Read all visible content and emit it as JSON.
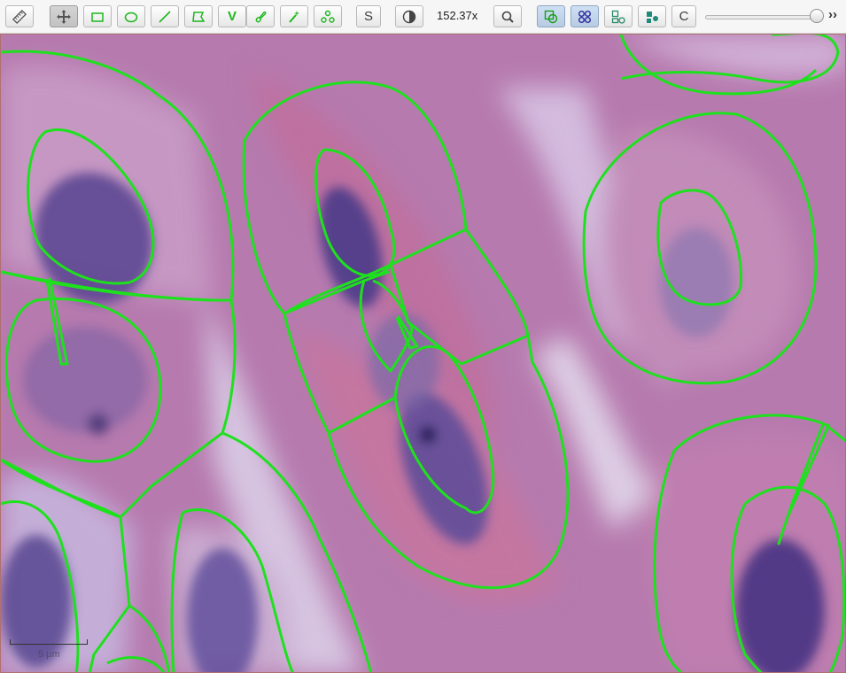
{
  "toolbar": {
    "tools": [
      {
        "name": "ruler-tool",
        "icon": "ruler-icon"
      },
      {
        "name": "pan-tool",
        "icon": "move-arrows-icon",
        "active": true
      },
      {
        "name": "rectangle-tool",
        "icon": "rectangle-icon"
      },
      {
        "name": "ellipse-tool",
        "icon": "ellipse-icon"
      },
      {
        "name": "line-tool",
        "icon": "line-icon"
      },
      {
        "name": "polygon-tool",
        "icon": "polygon-icon"
      },
      {
        "name": "polyline-tool",
        "icon": "v-letter-icon",
        "label": "V"
      },
      {
        "name": "brush-tool",
        "icon": "brush-icon"
      },
      {
        "name": "wand-tool",
        "icon": "magic-wand-icon"
      },
      {
        "name": "points-tool",
        "icon": "points-icon"
      },
      {
        "name": "selection-mode",
        "icon": "s-letter-icon",
        "label": "S"
      },
      {
        "name": "contrast-toggle",
        "icon": "contrast-icon"
      }
    ],
    "zoom_label": "152.37x",
    "right_tools": [
      {
        "name": "zoom-button",
        "icon": "magnifier-icon"
      },
      {
        "name": "overlay-toggle",
        "icon": "overlay-icon",
        "on": true
      },
      {
        "name": "detections-toggle",
        "icon": "detections-icon",
        "on": true
      },
      {
        "name": "annotations-toggle",
        "icon": "annotation-shapes-icon"
      },
      {
        "name": "cells-toggle",
        "icon": "cells-icon"
      },
      {
        "name": "c-toggle",
        "icon": "c-letter-icon",
        "label": "C"
      }
    ],
    "opacity_slider_value": 1.0,
    "overflow_label": "››"
  },
  "viewer": {
    "scale_bar_label": "5 µm",
    "annotation_color": "#1ee11e",
    "tissue_base_color": "#b67aae",
    "nucleus_color": "#55428f"
  }
}
